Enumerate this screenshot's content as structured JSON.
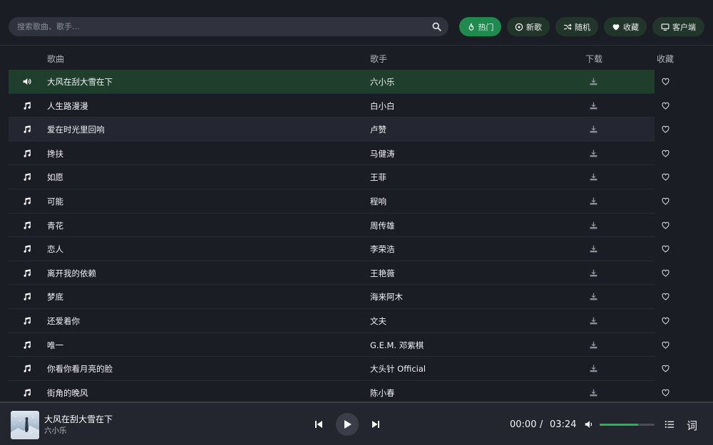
{
  "search": {
    "placeholder": "搜索歌曲、歌手..."
  },
  "nav": [
    {
      "label": "热门",
      "icon": "fire-icon",
      "active": true
    },
    {
      "label": "新歌",
      "icon": "disc-icon",
      "active": false
    },
    {
      "label": "随机",
      "icon": "shuffle-icon",
      "active": false
    },
    {
      "label": "收藏",
      "icon": "heart-icon",
      "active": false
    },
    {
      "label": "客户端",
      "icon": "monitor-icon",
      "active": false
    }
  ],
  "table": {
    "headers": {
      "song": "歌曲",
      "artist": "歌手",
      "download": "下载",
      "favorite": "收藏"
    },
    "rows": [
      {
        "song": "大风在刮大雪在下",
        "artist": "六小乐",
        "state": "playing"
      },
      {
        "song": "人生路漫漫",
        "artist": "白小白",
        "state": ""
      },
      {
        "song": "爱在时光里回响",
        "artist": "卢赞",
        "state": "hover"
      },
      {
        "song": "搀扶",
        "artist": "马健涛",
        "state": ""
      },
      {
        "song": "如愿",
        "artist": "王菲",
        "state": ""
      },
      {
        "song": "可能",
        "artist": "程响",
        "state": ""
      },
      {
        "song": "青花",
        "artist": "周传雄",
        "state": ""
      },
      {
        "song": "恋人",
        "artist": "李荣浩",
        "state": ""
      },
      {
        "song": "离开我的依赖",
        "artist": "王艳薇",
        "state": ""
      },
      {
        "song": "梦底",
        "artist": "海来阿木",
        "state": ""
      },
      {
        "song": "还爱着你",
        "artist": "文夫",
        "state": ""
      },
      {
        "song": "唯一",
        "artist": "G.E.M. 邓紫棋",
        "state": ""
      },
      {
        "song": "你看你看月亮的脸",
        "artist": "大头针 Official",
        "state": ""
      },
      {
        "song": "街角的晚风",
        "artist": "陈小春",
        "state": ""
      }
    ]
  },
  "player": {
    "title": "大风在刮大雪在下",
    "artist": "六小乐",
    "current_time": "00:00",
    "separator": "/",
    "duration": "03:24",
    "volume": 0.7,
    "lyrics_label": "词"
  },
  "colors": {
    "accent": "#1db954",
    "active_button": "#1e8a4d",
    "playing_row": "#1f3f2c"
  }
}
